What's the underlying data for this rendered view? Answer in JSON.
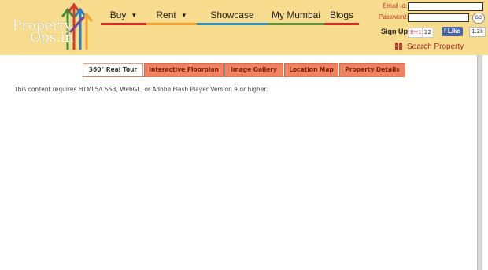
{
  "logo": {
    "line1": "Property",
    "line2": "Ops.in"
  },
  "nav": {
    "items": [
      {
        "label": "Buy",
        "has_dropdown": true,
        "color": "#d42b28"
      },
      {
        "label": "Rent",
        "has_dropdown": true,
        "color": "#f39c2c"
      },
      {
        "label": "Showcase",
        "has_dropdown": false,
        "color": "#2b8fbd"
      },
      {
        "label": "My Mumbai",
        "has_dropdown": false,
        "color": "#5e8f3a"
      },
      {
        "label": "Blogs",
        "has_dropdown": false,
        "color": "#d42b28"
      }
    ]
  },
  "login": {
    "email_label": "Email Id:",
    "email_value": "",
    "password_label": "Password:",
    "password_value": "",
    "go_label": "GO",
    "signup_label": "Sign Up",
    "gplus_label": "8+1",
    "gplus_count": "22",
    "fb_label": "Like",
    "fb_count": "1.2k"
  },
  "search_property": {
    "label": "Search Property",
    "icon": "grid-icon"
  },
  "tabs": [
    {
      "label": "360° Real Tour",
      "active": true
    },
    {
      "label": "Interactive Floorplan",
      "active": false
    },
    {
      "label": "Image Gallery",
      "active": false
    },
    {
      "label": "Location Map",
      "active": false
    },
    {
      "label": "Property Details",
      "active": false
    }
  ],
  "content": {
    "notice": "This content requires HTML5/CSS3, WebGL, or Adobe Flash Player Version 9 or higher."
  },
  "colors": {
    "header_bg": "#f8dc8e",
    "tab_bg": "#f08363",
    "accent_red": "#c0392b"
  }
}
